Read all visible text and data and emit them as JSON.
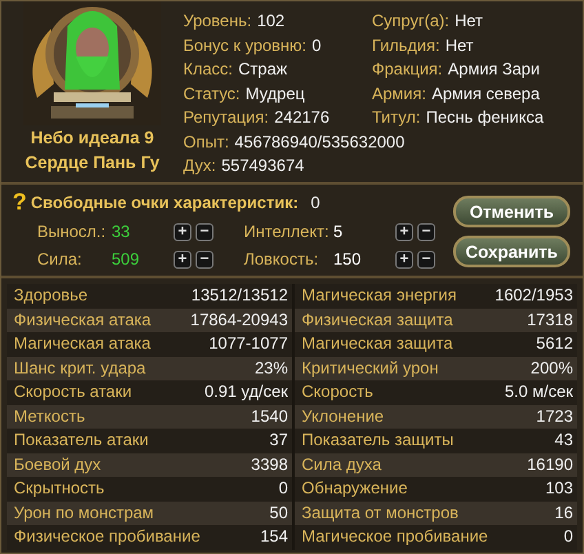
{
  "portrait": {
    "kind": "picture",
    "names": [
      "Небо идеала 9",
      "Сердце Пань Гу"
    ]
  },
  "info": [
    {
      "label": "Уровень:",
      "value": "102"
    },
    {
      "label": "Супруг(а):",
      "value": "Нет"
    },
    {
      "label": "Бонус к уровню:",
      "value": "0"
    },
    {
      "label": "Гильдия:",
      "value": "Нет"
    },
    {
      "label": "Класс:",
      "value": "Страж"
    },
    {
      "label": "Фракция:",
      "value": "Армия Зари"
    },
    {
      "label": "Статус:",
      "value": "Мудрец"
    },
    {
      "label": "Армия:",
      "value": "Армия севера"
    },
    {
      "label": "Репутация:",
      "value": "242176"
    },
    {
      "label": "Титул:",
      "value": "Песнь феникса"
    }
  ],
  "info_wide": [
    {
      "label": "Опыт:",
      "value": "456786940/535632000"
    },
    {
      "label": "Дух:",
      "value": "557493674"
    }
  ],
  "attributes": {
    "help": "?",
    "title": "Свободные очки характеристик:",
    "free": "0",
    "items": [
      {
        "label": "Выносл.:",
        "value": "33",
        "boosted": true,
        "plus": "+",
        "minus": "−"
      },
      {
        "label": "Интеллект:",
        "value": "5",
        "boosted": false,
        "plus": "+",
        "minus": "−"
      },
      {
        "label": "Сила:",
        "value": "509",
        "boosted": true,
        "plus": "+",
        "minus": "−"
      },
      {
        "label": "Ловкость:",
        "value": "150",
        "boosted": false,
        "plus": "+",
        "minus": "−"
      }
    ],
    "buttons": [
      "Отменить",
      "Сохранить"
    ]
  },
  "stats": [
    {
      "label": "Здоровье",
      "value": "13512/13512"
    },
    {
      "label": "Магическая энергия",
      "value": "1602/1953"
    },
    {
      "label": "Физическая атака",
      "value": "17864-20943"
    },
    {
      "label": "Физическая защита",
      "value": "17318"
    },
    {
      "label": "Магическая атака",
      "value": "1077-1077"
    },
    {
      "label": "Магическая защита",
      "value": "5612"
    },
    {
      "label": "Шанс крит. удара",
      "value": "23%"
    },
    {
      "label": "Критический урон",
      "value": "200%"
    },
    {
      "label": "Скорость атаки",
      "value": "0.91 уд/сек"
    },
    {
      "label": "Скорость",
      "value": "5.0 м/сек"
    },
    {
      "label": "Меткость",
      "value": "1540"
    },
    {
      "label": "Уклонение",
      "value": "1723"
    },
    {
      "label": "Показатель атаки",
      "value": "37"
    },
    {
      "label": "Показатель защиты",
      "value": "43"
    },
    {
      "label": "Боевой дух",
      "value": "3398"
    },
    {
      "label": "Сила духа",
      "value": "16190"
    },
    {
      "label": "Скрытность",
      "value": "0"
    },
    {
      "label": "Обнаружение",
      "value": "103"
    },
    {
      "label": "Урон по монстрам",
      "value": "50"
    },
    {
      "label": "Защита от монстров",
      "value": "16"
    },
    {
      "label": "Физическое пробивание",
      "value": "154"
    },
    {
      "label": "Магическое пробивание",
      "value": "0"
    }
  ]
}
